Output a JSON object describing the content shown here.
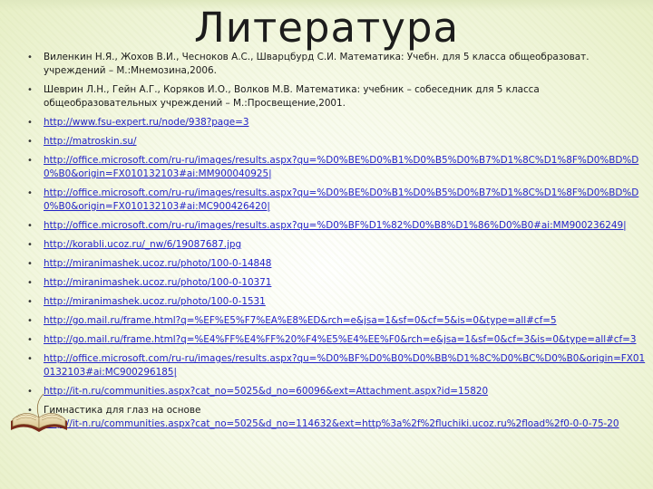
{
  "title": "Литература",
  "references": [
    {
      "type": "text",
      "text": "Виленкин Н.Я., Жохов В.И., Чесноков А.С., Шварцбурд С.И. Математика: Учебн. для 5 класса общеобразоват. учреждений – М.:Мнемозина,2006."
    },
    {
      "type": "text",
      "text": "Шеврин Л.Н., Гейн А.Г., Коряков И.О., Волков М.В. Математика: учебник – собеседник для 5 класса общеобразовательных учреждений – М.:Просвещение,2001."
    },
    {
      "type": "link",
      "text": "http://www.fsu-expert.ru/node/938?page=3"
    },
    {
      "type": "link",
      "text": "http://matroskin.su/"
    },
    {
      "type": "link",
      "text": "http://office.microsoft.com/ru-ru/images/results.aspx?qu=%D0%BE%D0%B1%D0%B5%D0%B7%D1%8C%D1%8F%D0%BD%D0%B0&origin=FX010132103#ai:MM900040925|"
    },
    {
      "type": "link",
      "text": "http://office.microsoft.com/ru-ru/images/results.aspx?qu=%D0%BE%D0%B1%D0%B5%D0%B7%D1%8C%D1%8F%D0%BD%D0%B0&origin=FX010132103#ai:MC900426420|"
    },
    {
      "type": "link",
      "text": "http://office.microsoft.com/ru-ru/images/results.aspx?qu=%D0%BF%D1%82%D0%B8%D1%86%D0%B0#ai:MM900236249|"
    },
    {
      "type": "link",
      "text": "http://korabli.ucoz.ru/_nw/6/19087687.jpg"
    },
    {
      "type": "link",
      "text": "http://miranimashek.ucoz.ru/photo/100-0-14848"
    },
    {
      "type": "link",
      "text": "http://miranimashek.ucoz.ru/photo/100-0-10371"
    },
    {
      "type": "link",
      "text": "http://miranimashek.ucoz.ru/photo/100-0-1531"
    },
    {
      "type": "link",
      "text": "http://go.mail.ru/frame.html?q=%EF%E5%F7%EA%E8%ED&rch=e&jsa=1&sf=0&cf=5&is=0&type=all#cf=5"
    },
    {
      "type": "link",
      "text": "http://go.mail.ru/frame.html?q=%E4%FF%E4%FF%20%F4%E5%E4%EE%F0&rch=e&jsa=1&sf=0&cf=3&is=0&type=all#cf=3"
    },
    {
      "type": "link",
      "text": "http://office.microsoft.com/ru-ru/images/results.aspx?qu=%D0%BF%D0%B0%D0%BB%D1%8C%D0%BC%D0%B0&origin=FX010132103#ai:MC900296185|"
    },
    {
      "type": "link",
      "text": "http://it-n.ru/communities.aspx?cat_no=5025&d_no=60096&ext=Attachment.aspx?id=15820"
    },
    {
      "type": "mixed",
      "text": "Гимнастика для глаз на основе ",
      "link": "http://it-n.ru/communities.aspx?cat_no=5025&d_no=114632&ext=http%3a%2f%2fluchiki.ucoz.ru%2fload%2f0-0-0-75-20"
    }
  ]
}
